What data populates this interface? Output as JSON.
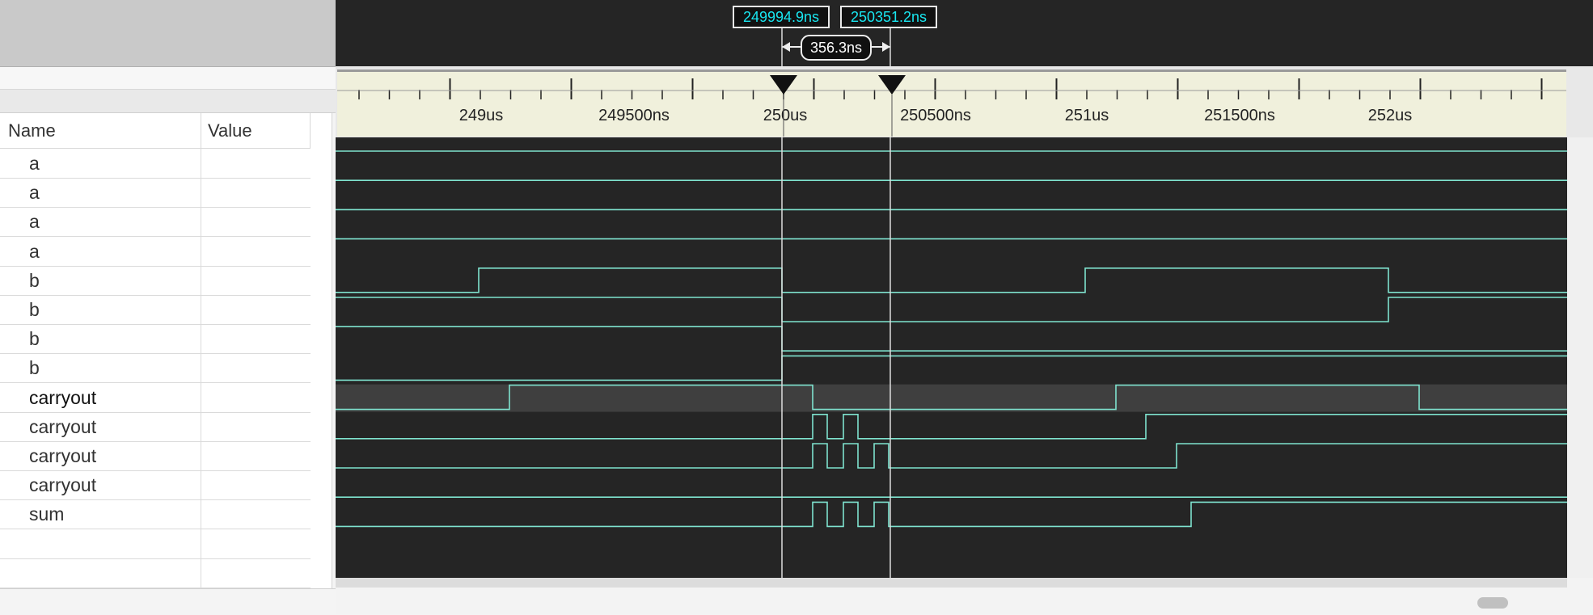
{
  "cursors": {
    "cursor1": "249994.9ns",
    "cursor2": "250351.2ns",
    "delta": "356.3ns"
  },
  "table": {
    "name_header": "Name",
    "value_header": "Value"
  },
  "signals": [
    {
      "name": "a",
      "value": ""
    },
    {
      "name": "a",
      "value": ""
    },
    {
      "name": "a",
      "value": ""
    },
    {
      "name": "a",
      "value": ""
    },
    {
      "name": "b",
      "value": ""
    },
    {
      "name": "b",
      "value": ""
    },
    {
      "name": "b",
      "value": ""
    },
    {
      "name": "b",
      "value": ""
    },
    {
      "name": "carryout",
      "value": ""
    },
    {
      "name": "carryout",
      "value": ""
    },
    {
      "name": "carryout",
      "value": ""
    },
    {
      "name": "carryout",
      "value": ""
    },
    {
      "name": "sum",
      "value": ""
    }
  ],
  "ruler_labels": [
    "249us",
    "249500ns",
    "250us",
    "250500ns",
    "251us",
    "251500ns",
    "252us"
  ],
  "colors": {
    "wave": "#7fe3cf",
    "background": "#252525",
    "cursor_label": "#19e6f0",
    "selected_row": "#3f3f3f"
  }
}
